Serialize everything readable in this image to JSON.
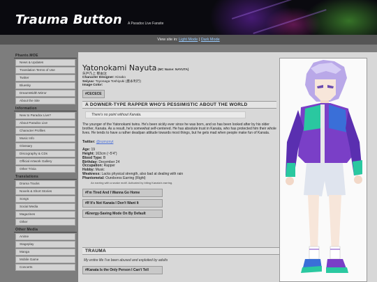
{
  "header": {
    "title": "Trauma Button",
    "subtitle": "A Paradox Live Fansite"
  },
  "viewbar": {
    "prefix": "View site in:",
    "light_mode": "Light Mode",
    "separator": "|",
    "dark_mode": "Dark Mode"
  },
  "sidebar": {
    "groups": [
      {
        "heading": "Phanto.MOE",
        "items": [
          "News & Updates",
          "Translation Terms of Use",
          "Twitter",
          "Bluesky",
          "DreamWidth Mirror",
          "About the Site"
        ]
      },
      {
        "heading": "Information",
        "items": [
          "New to Paradox Live?",
          "About Paradox Live",
          "Character Profiles",
          "Music Info",
          "Glossary",
          "Discography & CDs",
          "Official Artwork Gallery",
          "Other Trivia"
        ]
      },
      {
        "heading": "Translations",
        "items": [
          "Drama Tracks",
          "Novels & Short Stories",
          "Songs",
          "Social Media",
          "Magazines",
          "Other"
        ]
      },
      {
        "heading": "Other Media",
        "items": [
          "Anime",
          "Stageplay",
          "Manga",
          "Mobile Game",
          "Concerts"
        ]
      }
    ]
  },
  "character": {
    "name": "Yatonokami Nayuta",
    "mc_name": "(MC Name: NAYUTA)",
    "japanese_name": "矢戸乃上 那由汰",
    "designer_label": "Character Designer:",
    "designer": "Kinako",
    "seiyuu_label": "Seiyuu:",
    "seiyuu": "Toyonaga Toshiyuki (豊永利行)",
    "image_color_label": "Image Color:",
    "image_color": "#CECECE",
    "tagline": "A DOWNER-TYPE RAPPER WHO'S PESSIMISTIC ABOUT THE WORLD",
    "quote": "There's no point without Kanata.",
    "description": "The younger of the Yatonokami twins. He's been sickly ever since he was born, and so has been looked after by his older brother, Kanata. As a result, he's somewhat self-centered. He has absolute trust in Kanata, who has protected him their whole lives. He tends to have a rather deadpan attitude towards most things, but he gets mad when people make fun of Kanata.",
    "twitter_label": "Twitter:",
    "twitter_handle": "@nzmznyt",
    "stats": [
      {
        "label": "Age:",
        "value": "19"
      },
      {
        "label": "Height:",
        "value": "163cm (~5'4\")"
      },
      {
        "label": "Blood Type:",
        "value": "B"
      },
      {
        "label": "Birthday:",
        "value": "December 24"
      },
      {
        "label": "Occupation:",
        "value": "Rapper"
      },
      {
        "label": "Hobby:",
        "value": "Music"
      },
      {
        "label": "Weakness:",
        "value": "Lacks physical strength, also bad at dealing with rain"
      },
      {
        "label": "Phantometal:",
        "value": "Ouroboros Earring (Right)"
      }
    ],
    "phantometal_note": "An earring with a snake motif. Activated by biting Kanata's earring.",
    "songs": [
      "#I'm Tired And I Wanna Go Home",
      "#If It's Not Kanata I Don't Want It",
      "#Energy-Saving Mode On By Default"
    ]
  },
  "trauma": {
    "heading": "TRAUMA",
    "text": "My entire life I've been abused and exploited by adults",
    "song": "#Kanata Is the Only Person I Can't Tell"
  },
  "colors": {
    "accent_link": "#4a6fd8",
    "image_color": "#CECECE"
  }
}
